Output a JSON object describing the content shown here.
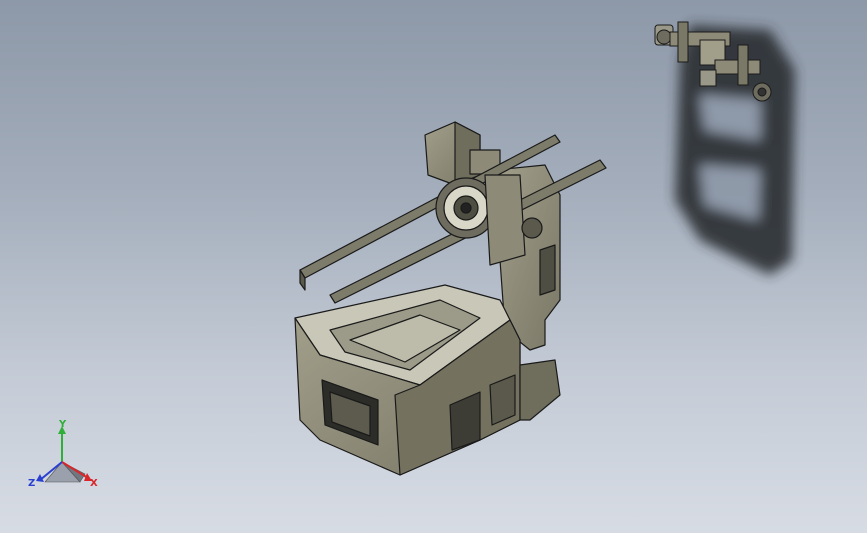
{
  "viewport": {
    "background_top": "#8d98a8",
    "background_bottom": "#d7dce4"
  },
  "model": {
    "body_color": "#8d8b78",
    "edge_color": "#1a1a1a",
    "shadow_color": "#2b2e33"
  },
  "triad": {
    "x_label": "X",
    "y_label": "Y",
    "z_label": "Z",
    "x_color": "#d8262a",
    "y_color": "#2fae3a",
    "z_color": "#2a3fd0"
  }
}
